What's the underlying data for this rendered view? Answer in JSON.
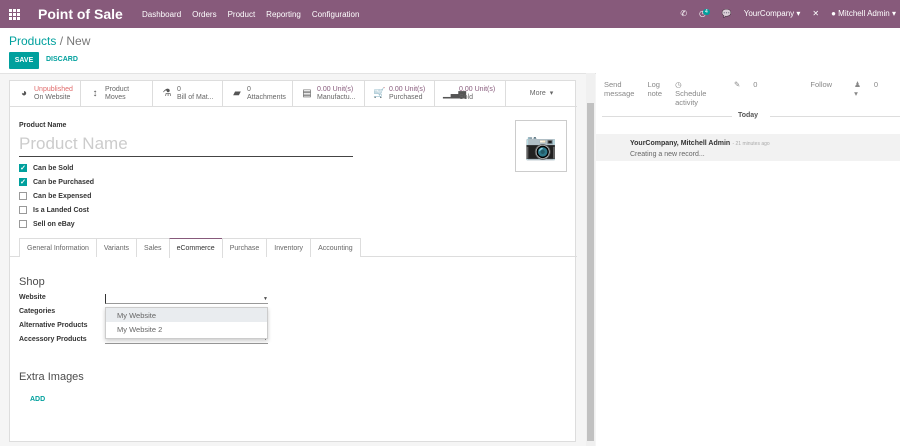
{
  "topbar": {
    "app_title": "Point of Sale",
    "menu": [
      "Dashboard",
      "Orders",
      "Product",
      "Reporting",
      "Configuration"
    ],
    "activity_count": "4",
    "company": "YourCompany",
    "user": "Mitchell Admin",
    "color": "#875A7B"
  },
  "breadcrumb": {
    "parent": "Products",
    "current": "New"
  },
  "actions": {
    "save": "SAVE",
    "discard": "DISCARD"
  },
  "smart_buttons": [
    {
      "icon": "globe-icon",
      "value": "Unpublished",
      "label": "On Website"
    },
    {
      "icon": "arrows-v-icon",
      "value": "Product",
      "label": "Moves"
    },
    {
      "icon": "flask-icon",
      "value": "0",
      "label": "Bill of Mat..."
    },
    {
      "icon": "book-icon",
      "value": "0",
      "label": "Attachments"
    },
    {
      "icon": "list-alt-icon",
      "value": "0.00 Unit(s)",
      "label": "Manufactu..."
    },
    {
      "icon": "shopping-cart-icon",
      "value": "0.00 Unit(s)",
      "label": "Purchased"
    },
    {
      "icon": "bar-chart-icon",
      "value": "0.00 Unit(s)",
      "label": "Sold"
    }
  ],
  "more": "More",
  "form": {
    "name_label": "Product Name",
    "name_placeholder": "Product Name",
    "checkboxes": [
      {
        "label": "Can be Sold",
        "checked": true
      },
      {
        "label": "Can be Purchased",
        "checked": true
      },
      {
        "label": "Can be Expensed",
        "checked": false
      },
      {
        "label": "Is a Landed Cost",
        "checked": false
      },
      {
        "label": "Sell on eBay",
        "checked": false
      }
    ],
    "tabs": [
      "General Information",
      "Variants",
      "Sales",
      "eCommerce",
      "Purchase",
      "Inventory",
      "Accounting"
    ],
    "active_tab": "eCommerce",
    "shop_title": "Shop",
    "fields": [
      "Website",
      "Categories",
      "Alternative Products",
      "Accessory Products"
    ],
    "website_options": [
      "My Website",
      "My Website 2"
    ],
    "extra_images_title": "Extra Images",
    "add": "ADD"
  },
  "chatter": {
    "send_message": "Send message",
    "log_note": "Log note",
    "schedule": "Schedule activity",
    "attachments": "0",
    "follow": "Follow",
    "followers": "0",
    "today": "Today",
    "author": "YourCompany, Mitchell Admin",
    "ago": "- 21 minutes ago",
    "body": "Creating a new record..."
  }
}
